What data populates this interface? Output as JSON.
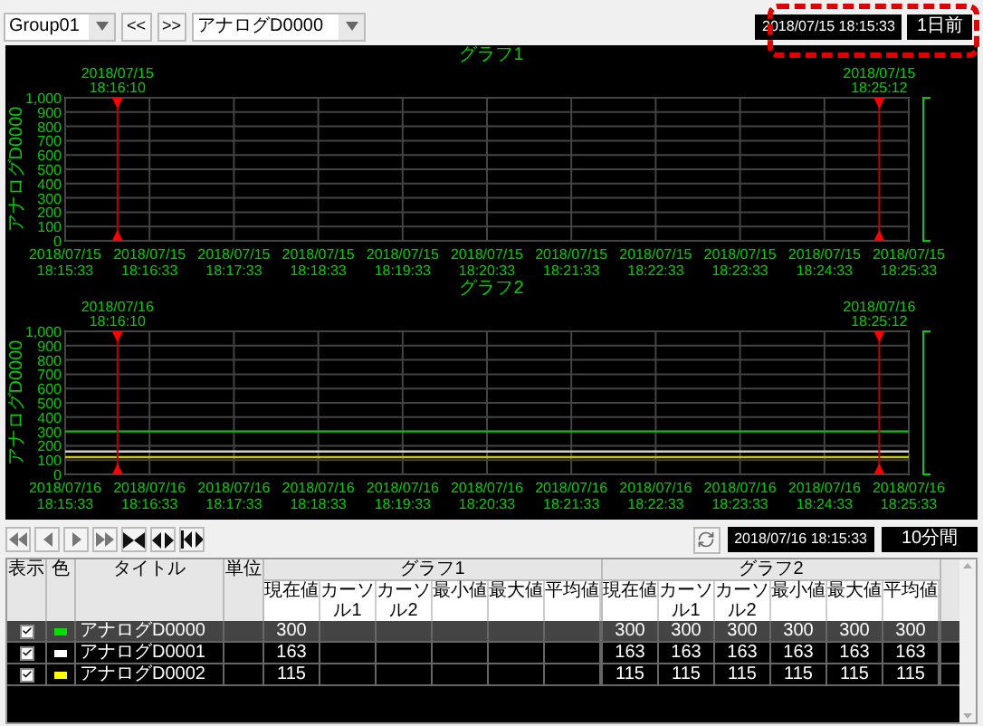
{
  "toolbar": {
    "group_select": {
      "value": "Group01"
    },
    "prev_button": "<<",
    "next_button": ">>",
    "tag_select": {
      "value": "アナログD0000"
    },
    "start_time": "2018/07/15 18:15:33",
    "offset_button": "1日前"
  },
  "graphs": [
    {
      "cursors": [
        {
          "date": "2018/07/15",
          "time": "18:16:10"
        },
        {
          "date": "2018/07/15",
          "time": "18:25:12"
        }
      ],
      "chart_data": {
        "type": "line",
        "title": "グラフ1",
        "ylabel": "アナログD0000",
        "ylim": [
          0,
          1000
        ],
        "grid": true,
        "categories": [
          "2018/07/15\n18:15:33",
          "2018/07/15\n18:16:33",
          "2018/07/15\n18:17:33",
          "2018/07/15\n18:18:33",
          "2018/07/15\n18:19:33",
          "2018/07/15\n18:20:33",
          "2018/07/15\n18:21:33",
          "2018/07/15\n18:22:33",
          "2018/07/15\n18:23:33",
          "2018/07/15\n18:24:33",
          "2018/07/15\n18:25:33"
        ],
        "yticks": [
          {
            "value": 0,
            "label": "0"
          },
          {
            "value": 100,
            "label": "100"
          },
          {
            "value": 200,
            "label": "200"
          },
          {
            "value": 300,
            "label": "300"
          },
          {
            "value": 400,
            "label": "400"
          },
          {
            "value": 500,
            "label": "500"
          },
          {
            "value": 600,
            "label": "600"
          },
          {
            "value": 700,
            "label": "700"
          },
          {
            "value": 800,
            "label": "800"
          },
          {
            "value": 900,
            "label": "900"
          },
          {
            "value": 1000,
            "label": "1,000"
          }
        ]
      }
    },
    {
      "cursors": [
        {
          "date": "2018/07/16",
          "time": "18:16:10"
        },
        {
          "date": "2018/07/16",
          "time": "18:25:12"
        }
      ],
      "chart_data": {
        "type": "line",
        "title": "グラフ2",
        "ylabel": "アナログD0000",
        "ylim": [
          0,
          1000
        ],
        "grid": true,
        "categories": [
          "2018/07/16\n18:15:33",
          "2018/07/16\n18:16:33",
          "2018/07/16\n18:17:33",
          "2018/07/16\n18:18:33",
          "2018/07/16\n18:19:33",
          "2018/07/16\n18:20:33",
          "2018/07/16\n18:21:33",
          "2018/07/16\n18:22:33",
          "2018/07/16\n18:23:33",
          "2018/07/16\n18:24:33",
          "2018/07/16\n18:25:33"
        ],
        "yticks": [
          {
            "value": 0,
            "label": "0"
          },
          {
            "value": 100,
            "label": "100"
          },
          {
            "value": 200,
            "label": "200"
          },
          {
            "value": 300,
            "label": "300"
          },
          {
            "value": 400,
            "label": "400"
          },
          {
            "value": 500,
            "label": "500"
          },
          {
            "value": 600,
            "label": "600"
          },
          {
            "value": 700,
            "label": "700"
          },
          {
            "value": 800,
            "label": "800"
          },
          {
            "value": 900,
            "label": "900"
          },
          {
            "value": 1000,
            "label": "1,000"
          }
        ],
        "series": [
          {
            "color": "#00c000",
            "values": [
              300,
              300,
              300,
              300,
              300,
              300,
              300,
              300,
              300,
              300,
              300
            ]
          },
          {
            "color": "#d0d0d0",
            "values": [
              160,
              160,
              160,
              160,
              160,
              160,
              160,
              160,
              160,
              160,
              160
            ]
          },
          {
            "color": "#c8c800",
            "values": [
              120,
              120,
              120,
              120,
              120,
              120,
              120,
              120,
              120,
              120,
              120
            ]
          }
        ]
      }
    }
  ],
  "controls": {
    "nav_buttons": [
      {
        "kind": "first"
      },
      {
        "kind": "prev"
      },
      {
        "kind": "next"
      },
      {
        "kind": "last"
      },
      {
        "kind": "narrow"
      },
      {
        "kind": "widen"
      },
      {
        "kind": "fit"
      }
    ],
    "time": "2018/07/16 18:15:33",
    "span_button": "10分間"
  },
  "table": {
    "columns": [
      "表示",
      "色",
      "タイトル",
      "単位"
    ],
    "groups": [
      {
        "title": "グラフ1",
        "columns": [
          "現在値",
          "カーソル1",
          "カーソル2",
          "最小値",
          "最大値",
          "平均値"
        ]
      },
      {
        "title": "グラフ2",
        "columns": [
          "現在値",
          "カーソル1",
          "カーソル2",
          "最小値",
          "最大値",
          "平均値"
        ]
      }
    ],
    "rows": [
      {
        "selected": true,
        "checked": true,
        "color": "#00e000",
        "title": "アナログD0000",
        "graph1": [
          "300"
        ],
        "graph2": [
          "300",
          "300",
          "300",
          "300",
          "300",
          "300"
        ]
      },
      {
        "selected": false,
        "checked": true,
        "color": "#ffffff",
        "title": "アナログD0001",
        "graph1": [
          "163"
        ],
        "graph2": [
          "163",
          "163",
          "163",
          "163",
          "163",
          "163"
        ]
      },
      {
        "selected": false,
        "checked": true,
        "color": "#ffff00",
        "title": "アナログD0002",
        "graph1": [
          "115"
        ],
        "graph2": [
          "115",
          "115",
          "115",
          "115",
          "115",
          "115"
        ]
      }
    ]
  }
}
